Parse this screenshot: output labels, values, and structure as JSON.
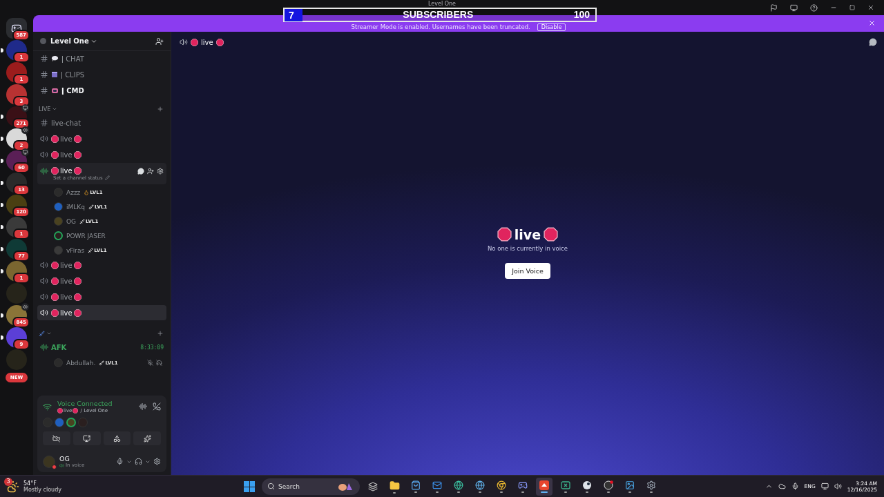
{
  "window": {
    "title": "Level One"
  },
  "overlay": {
    "count": "7",
    "label": "SUBSCRIBERS",
    "goal": "100"
  },
  "banner": {
    "text": "Streamer Mode is enabled. Usernames have been truncated.",
    "action": "Disable"
  },
  "servers": [
    {
      "kind": "home",
      "badge": "587",
      "unread": false,
      "screen_sharing": false,
      "voice_active": false,
      "color": "#2b2d31"
    },
    {
      "kind": "server",
      "badge": "1",
      "unread": true,
      "screen_sharing": false,
      "voice_active": false,
      "color": "#1f2a8a"
    },
    {
      "kind": "server",
      "badge": "1",
      "unread": false,
      "screen_sharing": false,
      "voice_active": false,
      "color": "#9b1c1c"
    },
    {
      "kind": "server",
      "badge": "3",
      "unread": false,
      "screen_sharing": false,
      "voice_active": false,
      "color": "#b83232"
    },
    {
      "kind": "server",
      "badge": "271",
      "unread": true,
      "screen_sharing": true,
      "voice_active": false,
      "color": "#3a1016"
    },
    {
      "kind": "server",
      "badge": "2",
      "unread": true,
      "screen_sharing": false,
      "voice_active": true,
      "color": "#d9d9d9"
    },
    {
      "kind": "server",
      "badge": "60",
      "unread": true,
      "screen_sharing": true,
      "voice_active": false,
      "color": "#5a1f56"
    },
    {
      "kind": "server",
      "badge": "13",
      "unread": true,
      "screen_sharing": false,
      "voice_active": false,
      "color": "#2a2a2a"
    },
    {
      "kind": "server",
      "badge": "120",
      "unread": true,
      "screen_sharing": false,
      "voice_active": false,
      "color": "#4a3f12"
    },
    {
      "kind": "server",
      "badge": "1",
      "unread": true,
      "screen_sharing": false,
      "voice_active": false,
      "color": "#3a3a3a"
    },
    {
      "kind": "server",
      "badge": "77",
      "unread": true,
      "screen_sharing": false,
      "voice_active": false,
      "color": "#0f3a36"
    },
    {
      "kind": "server",
      "badge": "1",
      "unread": true,
      "screen_sharing": false,
      "voice_active": false,
      "color": "#7a6630"
    },
    {
      "kind": "server",
      "unread": false,
      "screen_sharing": false,
      "voice_active": false,
      "color": "#26241a"
    },
    {
      "kind": "server",
      "badge": "845",
      "unread": true,
      "screen_sharing": false,
      "voice_active": true,
      "color": "#8a7438"
    },
    {
      "kind": "server",
      "badge": "9",
      "unread": true,
      "screen_sharing": false,
      "voice_active": false,
      "color": "#5b3fd6"
    },
    {
      "kind": "server",
      "unread": false,
      "screen_sharing": false,
      "voice_active": false,
      "color": "#26241a"
    }
  ],
  "new_badge": "NEW",
  "guild": {
    "name": "Level One"
  },
  "top_channels": [
    {
      "name": "ǀ CHAT",
      "unread": false
    },
    {
      "name": "ǀ CLIPS",
      "unread": false
    },
    {
      "name": "ǀ CMD",
      "unread": true
    }
  ],
  "categories": [
    {
      "name": "LIVE",
      "expanded": true,
      "channels": [
        {
          "kind": "text",
          "name": "live-chat",
          "selected": false
        },
        {
          "kind": "voice",
          "name": "live",
          "selected": false,
          "hovered": false,
          "speaking": false
        },
        {
          "kind": "voice",
          "name": "live",
          "selected": false,
          "hovered": false,
          "speaking": false
        },
        {
          "kind": "voice",
          "name": "live",
          "selected": false,
          "hovered": true,
          "speaking": true,
          "status": "Set a channel status",
          "members": [
            {
              "name": "Azzz",
              "tag": "LVL1",
              "speaking": false
            },
            {
              "name": "iMLKq",
              "tag": "LVL1",
              "speaking": false
            },
            {
              "name": "OG",
              "tag": "LVL1",
              "speaking": false
            },
            {
              "name": "POWR JASER",
              "speaking": true
            },
            {
              "name": "vFiras",
              "tag": "LVL1",
              "speaking": false
            }
          ]
        },
        {
          "kind": "voice",
          "name": "live",
          "selected": false,
          "hovered": false,
          "speaking": false
        },
        {
          "kind": "voice",
          "name": "live",
          "selected": false,
          "hovered": false,
          "speaking": false
        },
        {
          "kind": "voice",
          "name": "live",
          "selected": false,
          "hovered": false,
          "speaking": false
        },
        {
          "kind": "voice",
          "name": "live",
          "selected": true,
          "hovered": false,
          "speaking": false
        }
      ]
    },
    {
      "expanded": true,
      "channels": [
        {
          "kind": "voice",
          "name": "AFK",
          "selected": false,
          "hovered": false,
          "speaking": true,
          "connected": true,
          "timer": "8:33:09",
          "members": [
            {
              "name": "Abdullah.",
              "tag": "LVL1",
              "speaking": false,
              "muted": true,
              "deafened": true
            }
          ]
        }
      ]
    }
  ],
  "voice": {
    "status": "Voice Connected",
    "channel": "live",
    "server": "/ Level One",
    "participants": [
      {
        "speaking": false
      },
      {
        "speaking": false
      },
      {
        "speaking": true
      },
      {
        "speaking": false
      }
    ]
  },
  "user": {
    "name": "OG",
    "status": "In voice",
    "do_not_disturb": true,
    "muted": false,
    "deafened": false
  },
  "main": {
    "channel": "live",
    "title": "live",
    "text": "No one is currently in voice",
    "button": "Join Voice"
  },
  "taskbar": {
    "weather": {
      "badge": "3",
      "temp": "54°F",
      "text": "Mostly cloudy"
    },
    "search": {
      "placeholder": "Search"
    },
    "apps": [
      {
        "running": false,
        "selected": false
      },
      {
        "running": true,
        "selected": false
      },
      {
        "running": true,
        "selected": false
      },
      {
        "running": true,
        "selected": false
      },
      {
        "running": true,
        "selected": false
      },
      {
        "running": true,
        "selected": false
      },
      {
        "running": true,
        "selected": false
      },
      {
        "running": true,
        "selected": false
      },
      {
        "running": true,
        "selected": true
      },
      {
        "running": true,
        "selected": false
      },
      {
        "running": true,
        "selected": false
      },
      {
        "running": true,
        "selected": false
      },
      {
        "running": true,
        "selected": false
      },
      {
        "running": true,
        "selected": false
      }
    ],
    "language": "ENG",
    "time": "3:24 AM",
    "date": "12/16/2025"
  }
}
